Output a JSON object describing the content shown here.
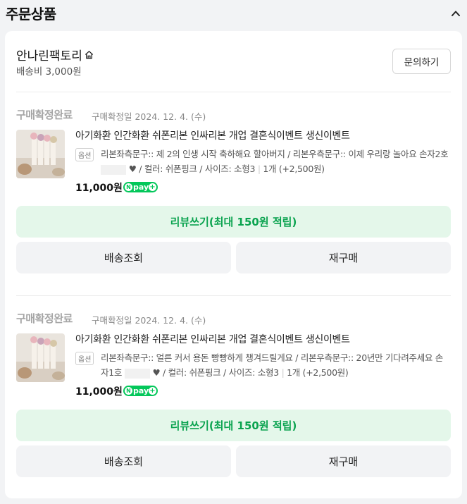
{
  "section": {
    "title": "주문상품"
  },
  "seller": {
    "name": "안나린팩토리",
    "shipping_fee": "배송비 3,000원",
    "inquiry_label": "문의하기"
  },
  "orders": [
    {
      "status": "구매확정완료",
      "confirm_date": "구매확정일 2024. 12. 4. (수)",
      "product_name": "아기화환 인간화환 쉬폰리본 인싸리본 개업 결혼식이벤트 생신이벤트",
      "option_badge": "옵션",
      "option_part1": "리본좌측문구:: 제 2의 인생 시작 축하해요 할아버지 / 리본우측문구:: 이제 우리랑 놀아요 손자2호",
      "option_part2": "♥ / 컬러: 쉬폰핑크 / 사이즈: 소형3",
      "quantity": "1개 (+2,500원)",
      "price": "11,000원",
      "npay_label": "pay",
      "review_label": "리뷰쓰기(최대 150원 적립)",
      "tracking_label": "배송조회",
      "reorder_label": "재구매"
    },
    {
      "status": "구매확정완료",
      "confirm_date": "구매확정일 2024. 12. 4. (수)",
      "product_name": "아기화환 인간화환 쉬폰리본 인싸리본 개업 결혼식이벤트 생신이벤트",
      "option_badge": "옵션",
      "option_part1": "리본좌측문구:: 얼른 커서 용돈 빵빵하게 챙겨드릴게요 / 리본우측문구:: 20년만 기다려주세요 손자1호",
      "option_part2": "♥ / 컬러: 쉬폰핑크 / 사이즈: 소형3",
      "quantity": "1개 (+2,500원)",
      "price": "11,000원",
      "npay_label": "pay",
      "review_label": "리뷰쓰기(최대 150원 적립)",
      "tracking_label": "배송조회",
      "reorder_label": "재구매"
    }
  ],
  "colors": {
    "accent_green": "#03c75a",
    "review_bg": "#e4f7ea",
    "review_text": "#0aa34f",
    "status_gray": "#a5a5a5"
  },
  "icons": {
    "collapse": "chevron-up-icon",
    "home": "home-icon",
    "npay": "npay-logo-icon"
  }
}
